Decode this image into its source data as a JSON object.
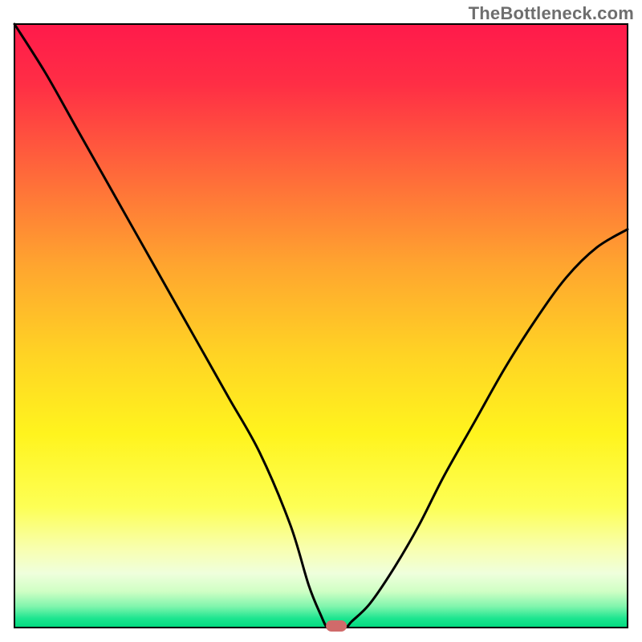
{
  "watermark": "TheBottleneck.com",
  "chart_data": {
    "type": "line",
    "title": "",
    "xlabel": "",
    "ylabel": "",
    "xlim": [
      0,
      100
    ],
    "ylim": [
      0,
      100
    ],
    "x": [
      0,
      5,
      10,
      15,
      20,
      25,
      30,
      35,
      40,
      45,
      48,
      50,
      51,
      52,
      54,
      55,
      58,
      62,
      66,
      70,
      75,
      80,
      85,
      90,
      95,
      100
    ],
    "values": [
      100,
      92,
      83,
      74,
      65,
      56,
      47,
      38,
      29,
      17,
      7,
      2,
      0,
      0,
      0,
      1,
      4,
      10,
      17,
      25,
      34,
      43,
      51,
      58,
      63,
      66
    ],
    "marker": {
      "x": 52.5,
      "y": 0
    },
    "gradient_stops": [
      {
        "offset": 0.0,
        "color": "#ff1a4b"
      },
      {
        "offset": 0.1,
        "color": "#ff2e45"
      },
      {
        "offset": 0.25,
        "color": "#ff6a3a"
      },
      {
        "offset": 0.4,
        "color": "#ffa52f"
      },
      {
        "offset": 0.55,
        "color": "#ffd424"
      },
      {
        "offset": 0.68,
        "color": "#fff41e"
      },
      {
        "offset": 0.8,
        "color": "#fdff55"
      },
      {
        "offset": 0.87,
        "color": "#f8ffb0"
      },
      {
        "offset": 0.91,
        "color": "#efffdc"
      },
      {
        "offset": 0.94,
        "color": "#d0ffc5"
      },
      {
        "offset": 0.965,
        "color": "#80f5ad"
      },
      {
        "offset": 0.985,
        "color": "#1ce58f"
      },
      {
        "offset": 1.0,
        "color": "#00d97e"
      }
    ]
  }
}
